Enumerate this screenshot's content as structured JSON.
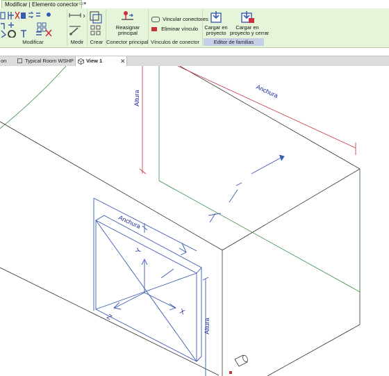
{
  "ribbon": {
    "context_tab": "Modificar | Elemento conector",
    "panels": {
      "modificar": "Modificar",
      "medir": "Medir",
      "crear": "Crear",
      "conector_principal": "Conector principal",
      "vinculos": "Vínculos de conector",
      "editor": "Editor de familias"
    },
    "buttons": {
      "reasignar_line1": "Reasignar",
      "reasignar_line2": "principal",
      "vincular": "Vincular conectores",
      "eliminar": "Eliminar vínculo",
      "cargar_line1": "Cargar en",
      "cargar_line2": "proyecto",
      "cargar_cerrar_line1": "Cargar en",
      "cargar_cerrar_line2": "proyecto y cerrar"
    }
  },
  "doc_tabs": {
    "partial": "on",
    "room": "Typical Room WSHP",
    "view": "View 1"
  },
  "drawing": {
    "dim_anchura_top": "Anchura",
    "dim_altura_top": "Altura",
    "dim_anchura_conn": "Anchura",
    "dim_altura_conn": "Altura",
    "axis_x": "X",
    "axis_y": "Y",
    "axis_z": "Z"
  },
  "colors": {
    "ribbon_bg": "#e6f4d9",
    "dimension_red": "#c8323c",
    "reference_green": "#3c8c46",
    "connector_blue": "#3a5cae",
    "model_line": "#333333"
  }
}
